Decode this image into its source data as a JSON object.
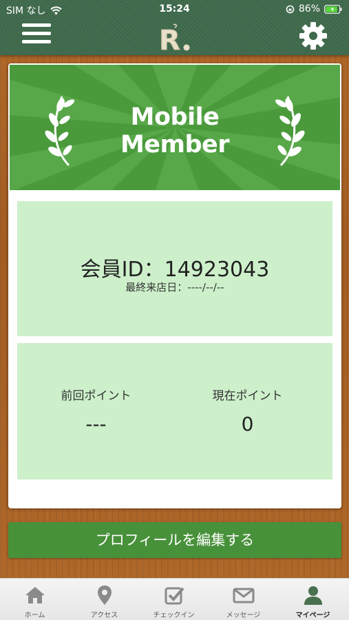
{
  "status_bar": {
    "carrier": "SIM なし",
    "time": "15:24",
    "battery": "86%"
  },
  "header": {
    "logo_letter": "R",
    "icons": [
      "menu-icon",
      "logo",
      "gear-icon"
    ]
  },
  "card": {
    "banner_title_line1": "Mobile",
    "banner_title_line2": "Member",
    "member_id": "会員ID：14923043",
    "last_visit": "最終来店日：----/--/--",
    "prev_points_label": "前回ポイント",
    "prev_points_value": "---",
    "current_points_label": "現在ポイント",
    "current_points_value": "0"
  },
  "edit_profile_label": "プロフィールを編集する",
  "tabs": [
    {
      "label": "ホーム",
      "icon": "home-icon"
    },
    {
      "label": "アクセス",
      "icon": "map-pin-icon"
    },
    {
      "label": "チェックイン",
      "icon": "checkin-icon"
    },
    {
      "label": "メッセージ",
      "icon": "envelope-icon"
    },
    {
      "label": "マイページ",
      "icon": "user-icon",
      "active": true
    }
  ],
  "colors": {
    "header_green": "#3f6a4c",
    "banner_green": "#4a9a3c",
    "panel_green": "#cdf0cb",
    "button_green": "#48913b",
    "wood": "#a45d22"
  }
}
